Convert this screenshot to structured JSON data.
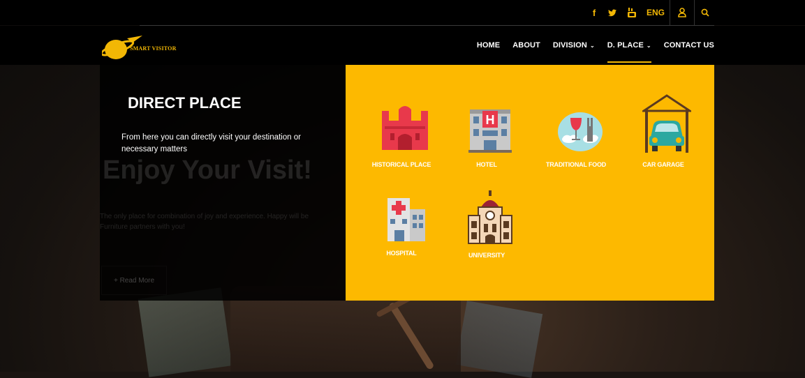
{
  "topbar": {
    "facebook_icon": "facebook-icon",
    "twitter_icon": "twitter-icon",
    "youtube_icon": "youtube-icon",
    "language": "ENG",
    "user_icon": "user-icon",
    "search_icon": "search-icon"
  },
  "brand": {
    "name": "SMART VISITOR"
  },
  "nav": {
    "items": [
      {
        "label": "HOME"
      },
      {
        "label": "ABOUT"
      },
      {
        "label": "DIVISION"
      },
      {
        "label": "D. PLACE"
      },
      {
        "label": "CONTACT US"
      }
    ]
  },
  "panel": {
    "title": "DIRECT PLACE",
    "description": "From here you can directly visit your destination or necessary matters"
  },
  "hero": {
    "heading": "Enjoy Your Visit!",
    "subtext": "The only place for combination of joy and experience. Happy will be Furniture partners with you!",
    "button": "+ Read More"
  },
  "places": [
    {
      "label": "HISTORICAL PLACE",
      "icon": "historical-place-icon"
    },
    {
      "label": "HOTEL",
      "icon": "hotel-icon"
    },
    {
      "label": "TRADITIONAL FOOD",
      "icon": "traditional-food-icon"
    },
    {
      "label": "CAR GARAGE",
      "icon": "car-garage-icon"
    },
    {
      "label": "HOSPITAL",
      "icon": "hospital-icon"
    },
    {
      "label": "UNIVERSITY",
      "icon": "university-icon"
    }
  ],
  "colors": {
    "accent": "#fdb900",
    "nav_bg": "#000000"
  }
}
